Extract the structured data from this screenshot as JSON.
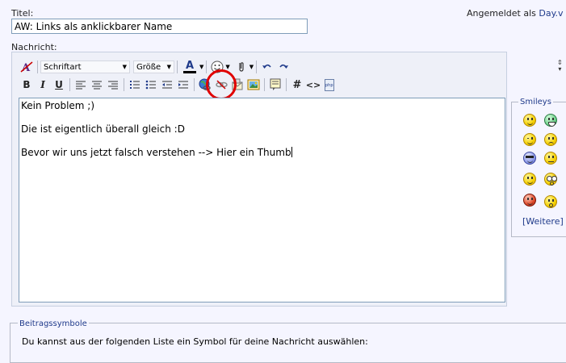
{
  "header": {
    "title_label": "Titel:",
    "logged_in_prefix": "Angemeldet als",
    "username": "Day.v"
  },
  "title_field": {
    "value": "AW: Links als anklickbarer Name"
  },
  "message_label": "Nachricht:",
  "toolbar": {
    "font_select": "Schriftart",
    "size_select": "Größe",
    "font_color_glyph": "A",
    "bold": "B",
    "italic": "I",
    "underline": "U",
    "hash": "#",
    "code": "<>",
    "php": "php"
  },
  "editor": {
    "lines": [
      "Kein Problem ;)",
      "Die ist eigentlich überall gleich :D",
      "Bevor wir uns jetzt falsch verstehen --> Hier ein Thumb"
    ]
  },
  "smileys": {
    "legend": "Smileys",
    "more_link": "[Weitere]"
  },
  "post_icons": {
    "legend": "Beitragssymbole",
    "instruction": "Du kannst aus der folgenden Liste ein Symbol für deine Nachricht auswählen:"
  },
  "colors": {
    "page_bg": "#f5f5ff",
    "link": "#1f3a8a",
    "highlight_ring": "#e00000"
  }
}
